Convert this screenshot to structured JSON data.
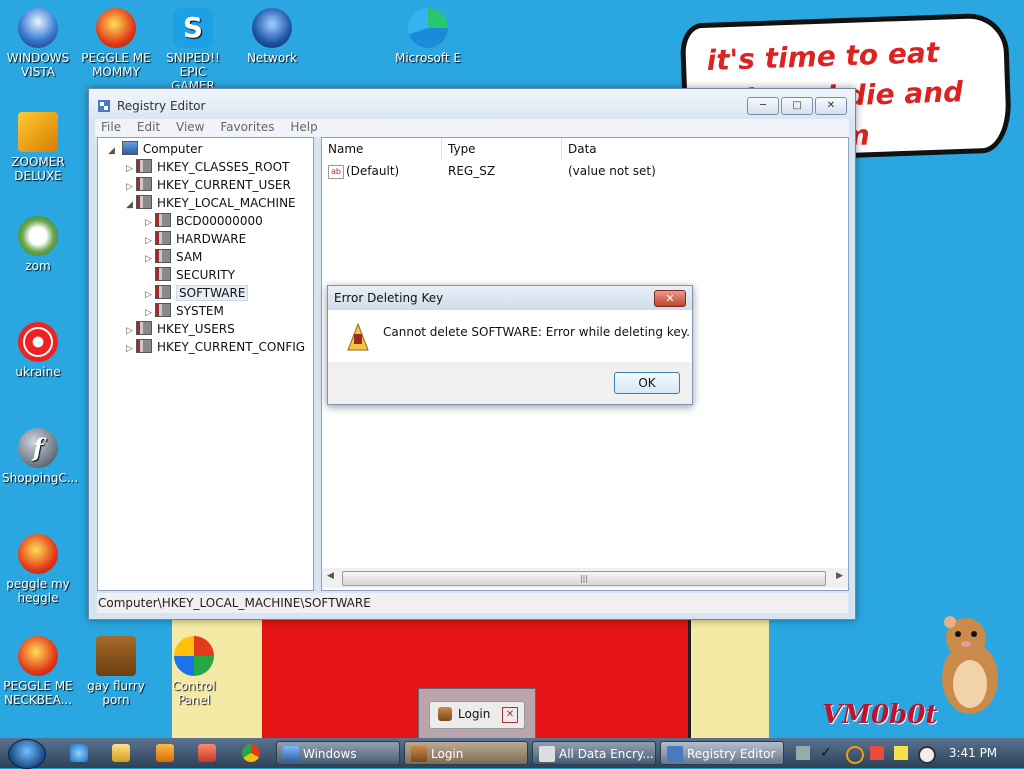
{
  "desktop": {
    "speech_bubble": "it's time to eat shit and die and chew gum",
    "signature": "VM0b0t",
    "icons": [
      {
        "label": "WINDOWS VISTA"
      },
      {
        "label": "PEGGLE ME MOMMY"
      },
      {
        "label": "SNIPED!! EPIC GAMER 360..."
      },
      {
        "label": "Network"
      },
      {
        "label": "Microsoft E"
      },
      {
        "label": "ZOOMER DELUXE"
      },
      {
        "label": "zom"
      },
      {
        "label": "ukraine"
      },
      {
        "label": "ShoppingC..."
      },
      {
        "label": "peggle my heggle"
      },
      {
        "label": "PEGGLE ME NECKBEA..."
      },
      {
        "label": "gay flurry porn"
      },
      {
        "label": "Control Panel"
      }
    ]
  },
  "regedit": {
    "title": "Registry Editor",
    "menu": [
      "File",
      "Edit",
      "View",
      "Favorites",
      "Help"
    ],
    "tree": [
      {
        "label": "Computer"
      },
      {
        "label": "HKEY_CLASSES_ROOT"
      },
      {
        "label": "HKEY_CURRENT_USER"
      },
      {
        "label": "HKEY_LOCAL_MACHINE"
      },
      {
        "label": "BCD00000000"
      },
      {
        "label": "HARDWARE"
      },
      {
        "label": "SAM"
      },
      {
        "label": "SECURITY"
      },
      {
        "label": "SOFTWARE"
      },
      {
        "label": "SYSTEM"
      },
      {
        "label": "HKEY_USERS"
      },
      {
        "label": "HKEY_CURRENT_CONFIG"
      }
    ],
    "columns": {
      "name": "Name",
      "type": "Type",
      "data": "Data"
    },
    "values": [
      {
        "name": "(Default)",
        "type": "REG_SZ",
        "data": "(value not set)"
      }
    ],
    "status_path": "Computer\\HKEY_LOCAL_MACHINE\\SOFTWARE"
  },
  "dialog": {
    "title": "Error Deleting Key",
    "message": "Cannot delete SOFTWARE:  Error while deleting key.",
    "ok_label": "OK"
  },
  "login_popup": {
    "label": "Login"
  },
  "taskbar": {
    "tasks": [
      {
        "label": "Windows"
      },
      {
        "label": "Login"
      },
      {
        "label": "All Data Encry..."
      },
      {
        "label": "Registry Editor"
      }
    ],
    "clock": "3:41 PM"
  },
  "colors": {
    "desktop": "#2aa7e0",
    "taskbar": "#2c4258",
    "error_close": "#c1432b"
  }
}
